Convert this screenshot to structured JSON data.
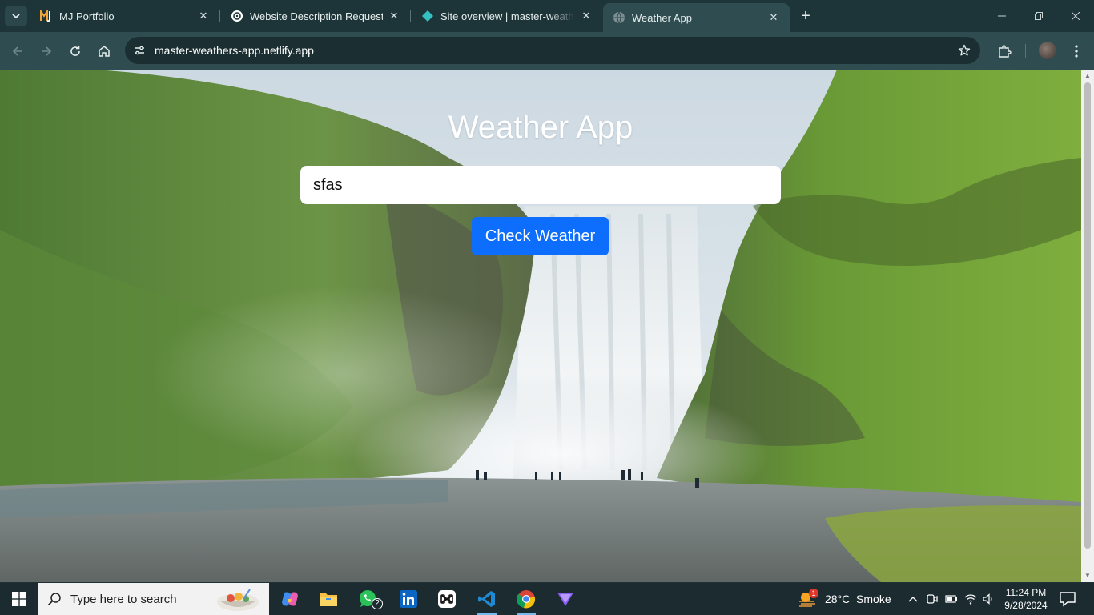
{
  "browser": {
    "tabs": [
      {
        "title": "MJ Portfolio",
        "icon": "mj-logo-icon"
      },
      {
        "title": "Website Description Request",
        "icon": "openai-icon"
      },
      {
        "title": "Site overview | master-weathers",
        "icon": "netlify-icon"
      },
      {
        "title": "Weather App",
        "icon": "globe-icon"
      }
    ],
    "active_tab": 3,
    "url": "master-weathers-app.netlify.app"
  },
  "page": {
    "title": "Weather App",
    "city_input_value": "sfas",
    "button_label": "Check Weather"
  },
  "taskbar": {
    "search_placeholder": "Type here to search",
    "whatsapp_badge": "2",
    "weather_badge": "1",
    "weather_text": "28°C  Smoke",
    "time": "11:24 PM",
    "date": "9/28/2024"
  },
  "colors": {
    "button": "#0d6efd",
    "chrome_dark": "#1d3438",
    "chrome_toolbar": "#2f4c51",
    "taskbar": "#1c2b30"
  }
}
